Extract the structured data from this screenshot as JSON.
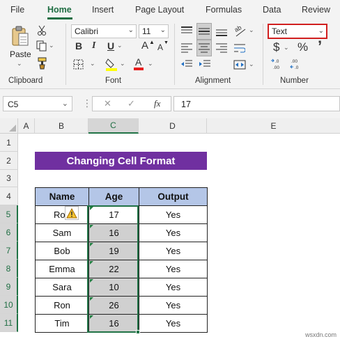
{
  "ribbon": {
    "tabs": [
      "File",
      "Home",
      "Insert",
      "Page Layout",
      "Formulas",
      "Data",
      "Review"
    ],
    "active_tab": "Home",
    "clipboard": {
      "paste_label": "Paste",
      "group_label": "Clipboard"
    },
    "font": {
      "family": "Calibri",
      "size": "11",
      "bold": "B",
      "italic": "I",
      "underline": "U",
      "grow": "A",
      "shrink": "A",
      "group_label": "Font"
    },
    "alignment": {
      "group_label": "Alignment"
    },
    "number": {
      "format": "Text",
      "currency": "$",
      "percent": "%",
      "comma": "’",
      "group_label": "Number"
    }
  },
  "formula_bar": {
    "name_box": "C5",
    "cancel_icon": "✕",
    "enter_icon": "✓",
    "fx_label": "fx",
    "formula": "17"
  },
  "grid": {
    "columns": [
      "A",
      "B",
      "C",
      "D",
      "E"
    ],
    "rows": [
      "1",
      "2",
      "3",
      "4",
      "5",
      "6",
      "7",
      "8",
      "9",
      "10",
      "11"
    ],
    "selected_column": "C",
    "title": "Changing Cell Format",
    "table": {
      "headers": [
        "Name",
        "Age",
        "Output"
      ],
      "rows": [
        [
          "Ro",
          "17",
          "Yes"
        ],
        [
          "Sam",
          "16",
          "Yes"
        ],
        [
          "Bob",
          "19",
          "Yes"
        ],
        [
          "Emma",
          "22",
          "Yes"
        ],
        [
          "Sara",
          "10",
          "Yes"
        ],
        [
          "Ron",
          "26",
          "Yes"
        ],
        [
          "Tim",
          "16",
          "Yes"
        ]
      ]
    }
  },
  "colors": {
    "accent": "#217346",
    "title_fill": "#7030a0",
    "header_fill": "#b4c6e7",
    "highlight_border": "#d11f1f"
  },
  "watermark": "wsxdn.com"
}
